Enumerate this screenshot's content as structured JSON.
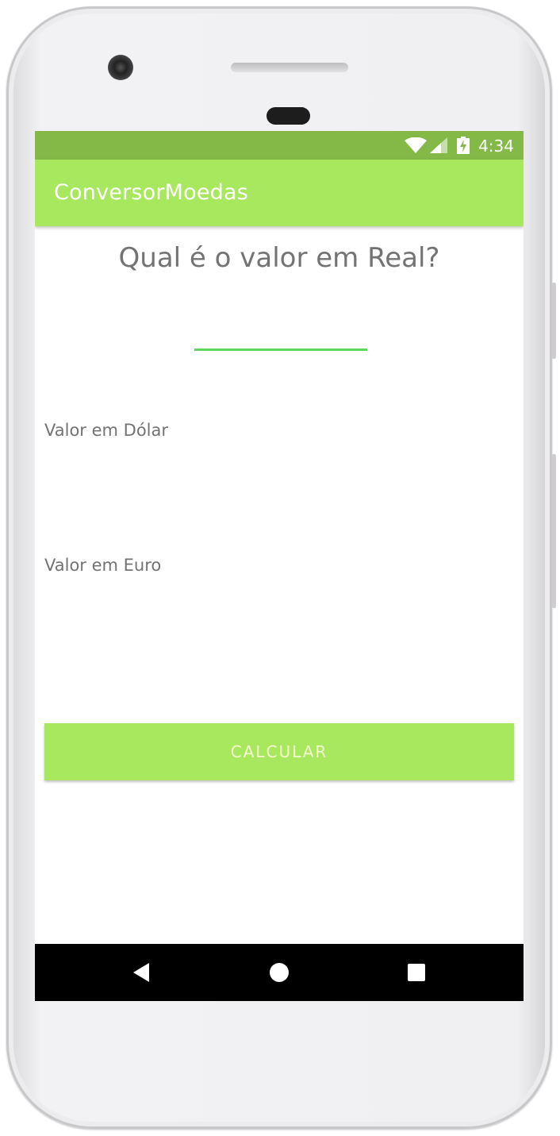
{
  "status_bar": {
    "time": "4:34",
    "icons": [
      "wifi-icon",
      "signal-icon",
      "battery-charging-icon"
    ],
    "color": "#84b948"
  },
  "app_bar": {
    "title": "ConversorMoedas",
    "color": "#a8e85e"
  },
  "main": {
    "question": "Qual é o valor em Real?",
    "real_input": {
      "value": "",
      "placeholder": ""
    },
    "dollar_label": "Valor em Dólar",
    "euro_label": "Valor em Euro",
    "calculate_button": "CALCULAR"
  },
  "nav_bar": {
    "icons": [
      "back-icon",
      "home-icon",
      "recents-icon"
    ]
  }
}
